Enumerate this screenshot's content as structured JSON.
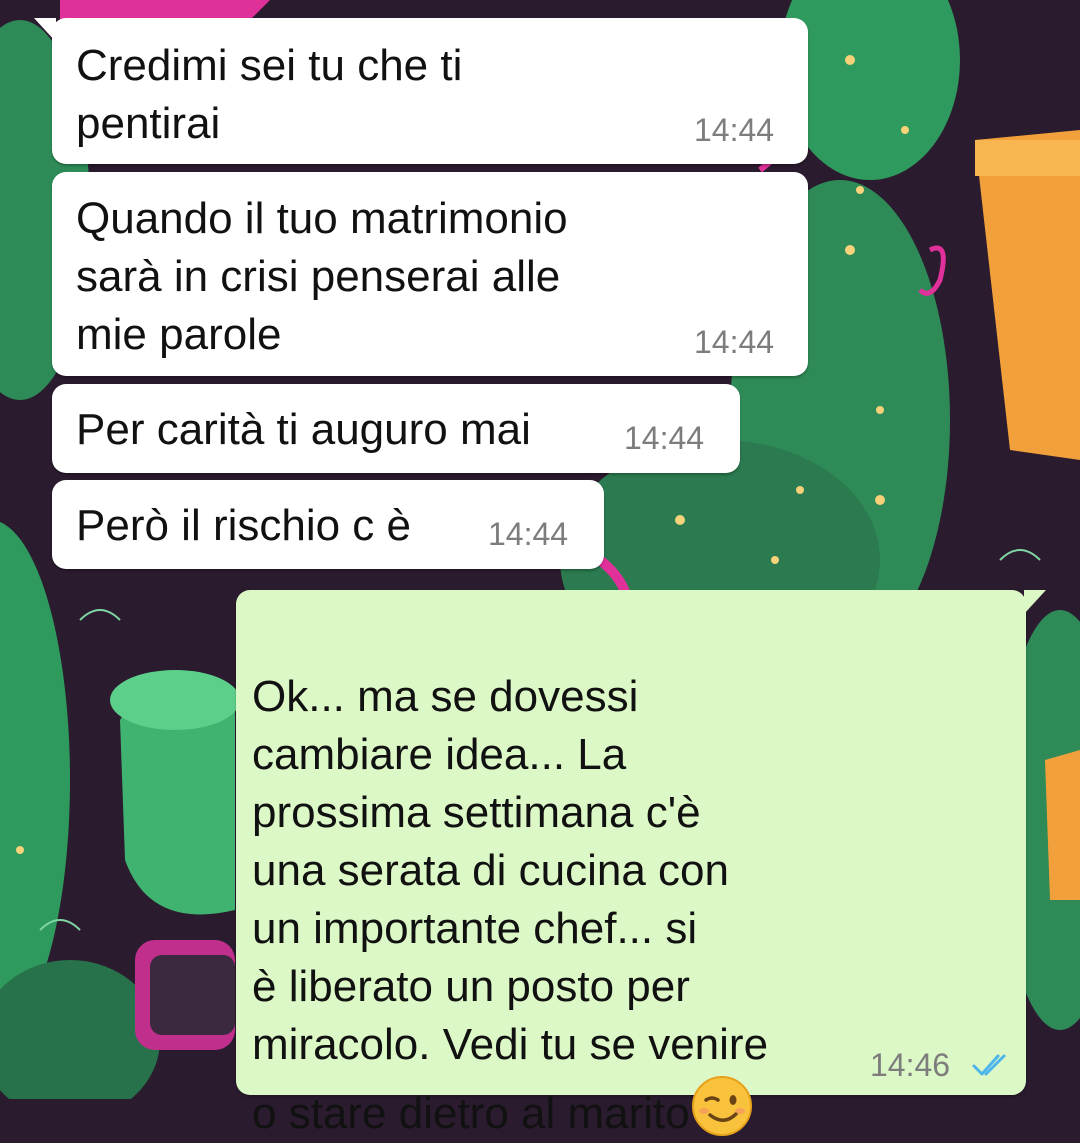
{
  "colors": {
    "incoming_bubble": "#ffffff",
    "outgoing_bubble": "#dcf8c6",
    "timestamp": "#7d7d7d",
    "read_ticks": "#4fb6ec",
    "wallpaper_base": "#2a1b2e",
    "cactus_green": "#2e8b57",
    "accent_pink": "#e0309a",
    "pot_orange": "#f2a03b"
  },
  "icons": {
    "read_receipt": "double-check-icon",
    "emoji": "winking-face-emoji"
  },
  "messages": [
    {
      "direction": "incoming",
      "text": "Credimi sei tu che ti\npentirai",
      "time": "14:44"
    },
    {
      "direction": "incoming",
      "text": "Quando il tuo matrimonio\nsarà in crisi penserai alle\nmie parole",
      "time": "14:44"
    },
    {
      "direction": "incoming",
      "text": "Per carità ti auguro mai",
      "time": "14:44"
    },
    {
      "direction": "incoming",
      "text": "Però il rischio c è",
      "time": "14:44"
    },
    {
      "direction": "outgoing",
      "text": "Ok... ma se dovessi\ncambiare idea... La\nprossima settimana c'è\nuna serata di cucina con\nun importante chef... si\nè liberato un posto per\nmiracolo. Vedi tu se venire\no stare dietro al marito",
      "time": "14:46",
      "status": "read"
    }
  ]
}
